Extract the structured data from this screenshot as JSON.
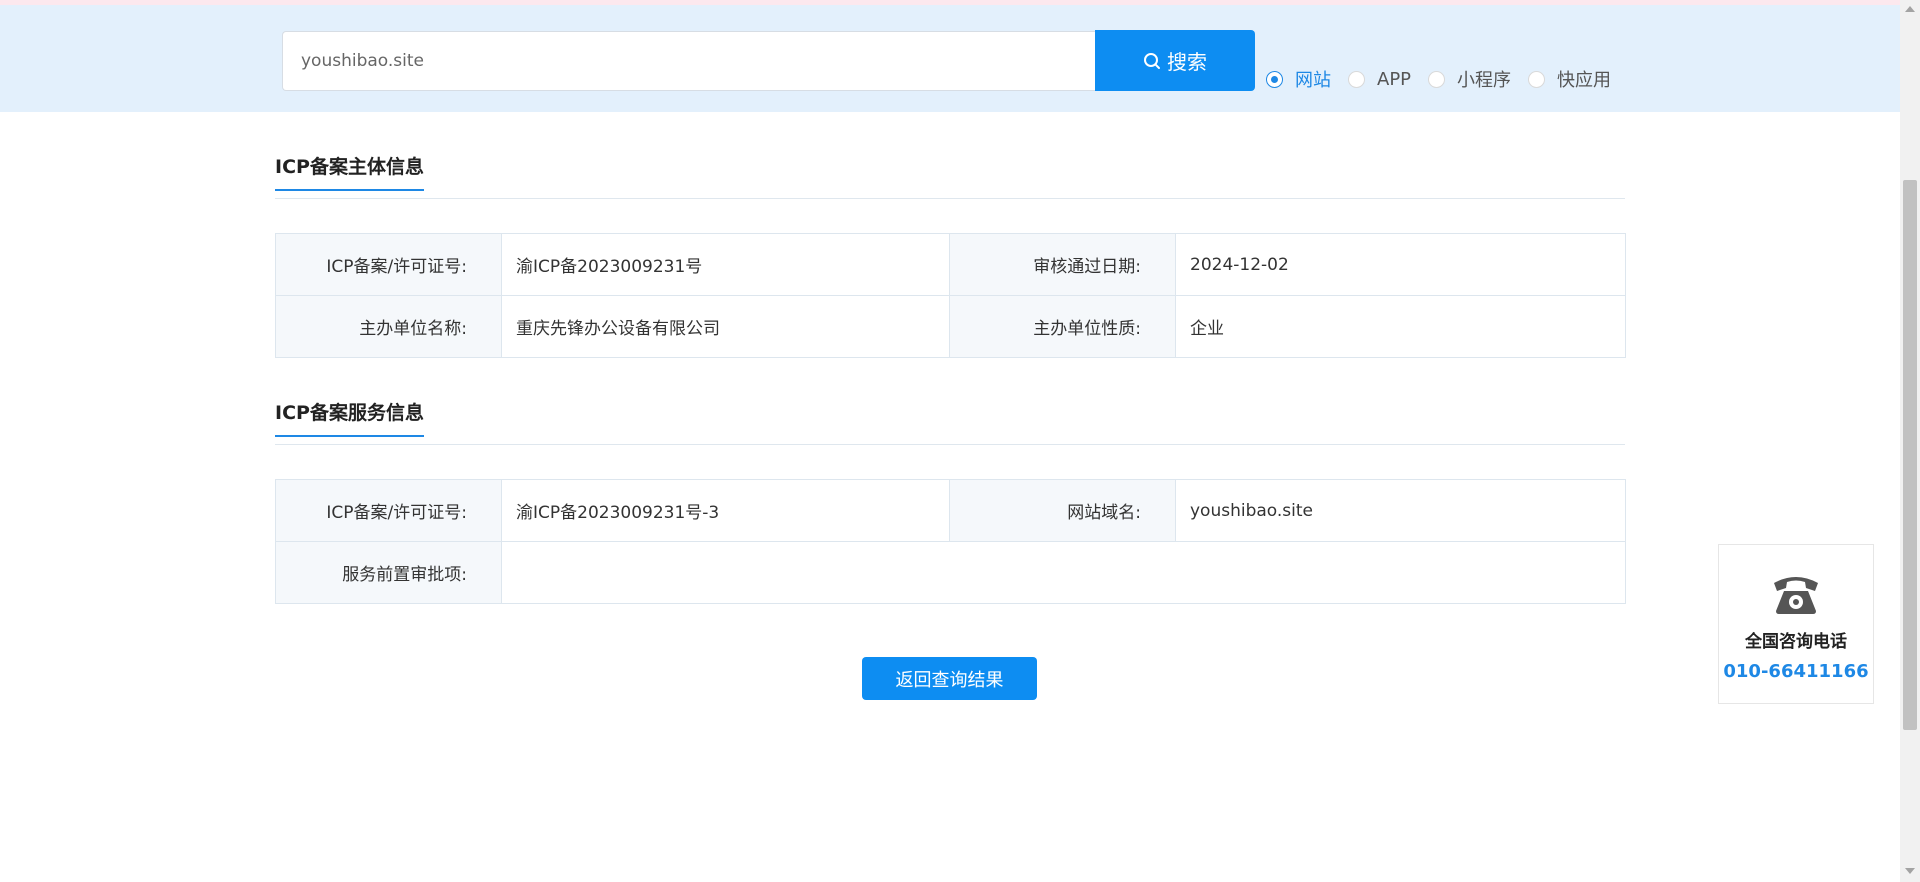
{
  "search": {
    "value": "youshibao.site",
    "button_label": "搜索"
  },
  "filters": [
    {
      "label": "网站",
      "checked": true
    },
    {
      "label": "APP",
      "checked": false
    },
    {
      "label": "小程序",
      "checked": false
    },
    {
      "label": "快应用",
      "checked": false
    }
  ],
  "entity_section": {
    "title": "ICP备案主体信息",
    "rows": [
      {
        "label1": "ICP备案/许可证号:",
        "value1": "渝ICP备2023009231号",
        "label2": "审核通过日期:",
        "value2": "2024-12-02"
      },
      {
        "label1": "主办单位名称:",
        "value1": "重庆先锋办公设备有限公司",
        "label2": "主办单位性质:",
        "value2": "企业"
      }
    ]
  },
  "service_section": {
    "title": "ICP备案服务信息",
    "row1": {
      "label1": "ICP备案/许可证号:",
      "value1": "渝ICP备2023009231号-3",
      "label2": "网站域名:",
      "value2": "youshibao.site"
    },
    "row2": {
      "label": "服务前置审批项:",
      "value": ""
    }
  },
  "back_button_label": "返回查询结果",
  "contact": {
    "icon": "telephone-icon",
    "title": "全国咨询电话",
    "phone": "010-66411166"
  },
  "colors": {
    "accent": "#0d8df2",
    "link_blue": "#1e88e5",
    "search_band": "#e3f0fc"
  }
}
